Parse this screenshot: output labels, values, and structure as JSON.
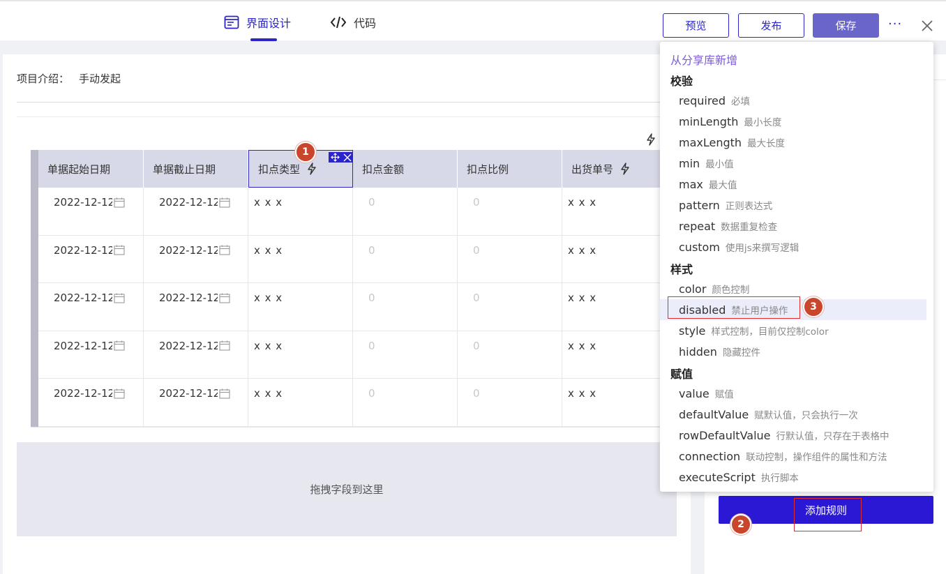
{
  "tabs": [
    {
      "label": "界面设计",
      "icon": "form-design-icon",
      "active": true
    },
    {
      "label": "代码",
      "icon": "code-icon",
      "active": false
    }
  ],
  "toolbar": {
    "preview_label": "预览",
    "publish_label": "发布",
    "save_label": "保存",
    "more_label": "···"
  },
  "form": {
    "intro_label": "项目介绍：",
    "intro_value": "手动发起",
    "dropzone_text": "拖拽字段到这里"
  },
  "table": {
    "headers": [
      {
        "label": "单据起始日期",
        "bolt": false
      },
      {
        "label": "单据截止日期",
        "bolt": false
      },
      {
        "label": "扣点类型",
        "bolt": true
      },
      {
        "label": "扣点金额",
        "bolt": false
      },
      {
        "label": "扣点比例",
        "bolt": false
      },
      {
        "label": "出货单号",
        "bolt": true
      }
    ],
    "rows": [
      {
        "start_date": "2022-12-12",
        "end_date": "2022-12-12",
        "type": "x x x",
        "amount": "0",
        "ratio": "0",
        "order_no": "x x x"
      },
      {
        "start_date": "2022-12-12",
        "end_date": "2022-12-12",
        "type": "x x x",
        "amount": "0",
        "ratio": "0",
        "order_no": "x x x"
      },
      {
        "start_date": "2022-12-12",
        "end_date": "2022-12-12",
        "type": "x x x",
        "amount": "0",
        "ratio": "0",
        "order_no": "x x x"
      },
      {
        "start_date": "2022-12-12",
        "end_date": "2022-12-12",
        "type": "x x x",
        "amount": "0",
        "ratio": "0",
        "order_no": "x x x"
      },
      {
        "start_date": "2022-12-12",
        "end_date": "2022-12-12",
        "type": "x x x",
        "amount": "0",
        "ratio": "0",
        "order_no": "x x x"
      }
    ]
  },
  "annotations": {
    "badge1": "1",
    "badge2": "2",
    "badge3": "3"
  },
  "right_panel": {
    "add_rule_label": "添加规则"
  },
  "dropdown": {
    "link": "从分享库新增",
    "groups": [
      {
        "title": "校验",
        "items": [
          {
            "name": "required",
            "desc": "必填"
          },
          {
            "name": "minLength",
            "desc": "最小长度"
          },
          {
            "name": "maxLength",
            "desc": "最大长度"
          },
          {
            "name": "min",
            "desc": "最小值"
          },
          {
            "name": "max",
            "desc": "最大值"
          },
          {
            "name": "pattern",
            "desc": "正则表达式"
          },
          {
            "name": "repeat",
            "desc": "数据重复检查"
          },
          {
            "name": "custom",
            "desc": "使用js来撰写逻辑"
          }
        ]
      },
      {
        "title": "样式",
        "items": [
          {
            "name": "color",
            "desc": "颜色控制"
          },
          {
            "name": "disabled",
            "desc": "禁止用户操作",
            "highlighted": true
          },
          {
            "name": "style",
            "desc": "样式控制，目前仅控制color"
          },
          {
            "name": "hidden",
            "desc": "隐藏控件"
          }
        ]
      },
      {
        "title": "赋值",
        "items": [
          {
            "name": "value",
            "desc": "赋值"
          },
          {
            "name": "defaultValue",
            "desc": "赋默认值，只会执行一次"
          },
          {
            "name": "rowDefaultValue",
            "desc": "行默认值，只存在于表格中"
          },
          {
            "name": "connection",
            "desc": "联动控制，操作组件的属性和方法"
          },
          {
            "name": "executeScript",
            "desc": "执行脚本"
          }
        ]
      }
    ]
  },
  "colors": {
    "accent": "#2a24c9",
    "save_bg": "#6a66c9",
    "annotation": "#c9452c",
    "highlight_box": "#e02e2e"
  }
}
